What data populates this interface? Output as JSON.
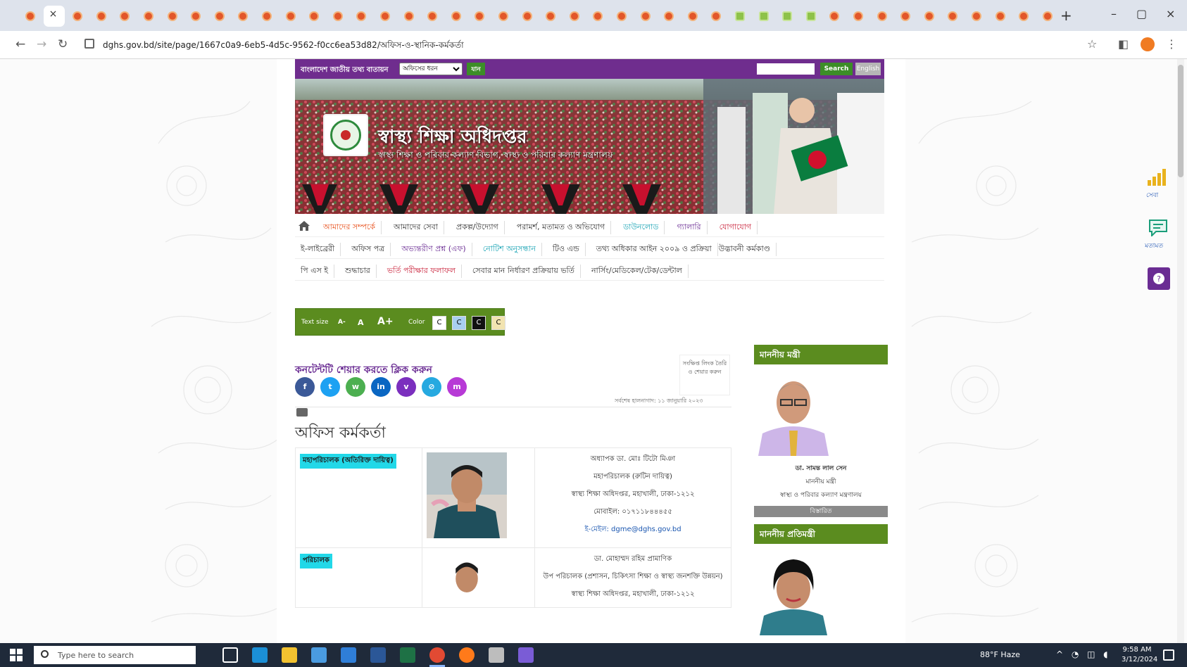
{
  "browser": {
    "active_tab_close": "×",
    "new_tab": "+",
    "window": {
      "minimize": "–",
      "maximize": "▢",
      "close": "×"
    },
    "nav": {
      "back": "←",
      "forward": "→",
      "reload": "↻"
    },
    "url": "dghs.gov.bd/site/page/1667c0a9-6eb5-4d5c-9562-f0cc6ea53d82/অফিস-ও-স্থানিক-কর্মকর্তা",
    "star_icon": "☆",
    "side_panel_icon": "◧",
    "menu_icon": "⋮"
  },
  "site": {
    "portal_label": "বাংলাদেশ জাতীয় তথ্য বাতায়ন",
    "office_select": "অফিসের ধরন",
    "go_label": "যান",
    "search_placeholder": "",
    "search_label": "Search",
    "language_label": "English",
    "title": "স্বাস্থ্য শিক্ষা অধিদপ্তর",
    "subtitle": "স্বাস্থ্য শিক্ষা ও পরিবার কল্যাণ বিভাগ, স্বাস্থ্য ও পরিবার কল্যাণ মন্ত্রণালয়"
  },
  "nav": {
    "row1": [
      "আমাদের সম্পর্কে",
      "আমাদের সেবা",
      "প্রকল্প/উদ্যোগ",
      "পরামর্শ, মতামত ও অভিযোগ",
      "ডাউনলোড",
      "গ্যালারি",
      "যোগাযোগ"
    ],
    "row2": [
      "ই-লাইব্রেরী",
      "অফিস পত্র",
      "অভ্যন্তরীণ প্রশ্ন (এফ)",
      "নোটিশ অনুসন্ধান",
      "টিও এন্ড",
      "তথ্য অধিকার আইন ২০০৯ ও প্রক্রিয়া",
      "উদ্ভাবনী কর্মকাণ্ড"
    ],
    "row3": [
      "পি এস ই",
      "শুদ্ধাচার",
      "ভর্তি পরীক্ষার ফলাফল",
      "সেবার মান নির্ধারণ প্রক্রিয়ায় ভর্তি",
      "নার্সিং/মেডিকেল/টেক/ডেন্টাল"
    ]
  },
  "accessibility": {
    "text_size_label": "Text size",
    "sizes": [
      "A-",
      "A",
      "A+"
    ],
    "color_label": "Color",
    "swatches": [
      {
        "label": "C",
        "color": "#ffffff"
      },
      {
        "label": "C",
        "color": "#a9cff0"
      },
      {
        "label": "C",
        "color": "#111111"
      },
      {
        "label": "C",
        "color": "#f2e4b1"
      }
    ]
  },
  "share": {
    "title": "কনটেন্টটি শেয়ার করতে ক্লিক করুন",
    "buttons": [
      {
        "name": "facebook",
        "label": "f",
        "color": "#3b5998"
      },
      {
        "name": "twitter",
        "label": "t",
        "color": "#1da1f2"
      },
      {
        "name": "whatsapp",
        "label": "w",
        "color": "#4caf50"
      },
      {
        "name": "linkedin",
        "label": "in",
        "color": "#0a66c2"
      },
      {
        "name": "viber",
        "label": "v",
        "color": "#7b2fbe"
      },
      {
        "name": "link",
        "label": "⊘",
        "color": "#26a9e0"
      },
      {
        "name": "messenger",
        "label": "m",
        "color": "#b73ad6"
      }
    ],
    "print_icon": "printer-icon",
    "short_link_label": "সংক্ষিপ্ত লিংক তৈরি ও শেয়ার করুন",
    "updated_text": "সর্বশেষ হালনাগাদ: ১১ জানুয়ারি ২০২৩"
  },
  "page": {
    "title": "অফিস কর্মকর্তা"
  },
  "officers": [
    {
      "role": "মহাপরিচালক (অতিরিক্ত দায়িত্ব)",
      "lines": [
        "অধ্যাপক ডা. মোঃ টিটো মিঞা",
        "মহাপরিচালক (রুটিন দায়িত্ব)",
        "স্বাস্থ্য শিক্ষা অধিদপ্তর, মহাখালী, ঢাকা-১২১২",
        "মোবাইল: ০১৭১১৮৪৪৪৫৫"
      ],
      "email": "ই-মেইল: dgme@dghs.gov.bd"
    },
    {
      "role": "পরিচালক",
      "lines": [
        "ডা. মোহাম্মদ রহিম প্রামাণিক",
        "উপ পরিচালক (প্রশাসন, চিকিৎসা শিক্ষা ও স্বাস্থ্য জনশক্তি উন্নয়ন)",
        "স্বাস্থ্য শিক্ষা অধিদপ্তর, মহাখালী, ঢাকা-১২১২"
      ],
      "email": ""
    }
  ],
  "sidebar": {
    "minister_heading": "মাননীয় মন্ত্রী",
    "minister_name": "ডা. সামন্ত লাল সেন",
    "minister_role": "মাননীয় মন্ত্রী",
    "minister_ministry": "স্বাস্থ্য ও পরিবার কল্যাণ মন্ত্রণালয়",
    "more_label": "বিস্তারিত",
    "state_minister_heading": "মাননীয় প্রতিমন্ত্রী"
  },
  "floating": {
    "stats_label": "সেবা",
    "chat_label": "মতামত"
  },
  "taskbar": {
    "search_placeholder": "Type here to search",
    "weather": "88°F Haze",
    "tray": "^ ◔ ◫ ◖",
    "time": "9:58 AM",
    "date": "3/12/2024"
  }
}
